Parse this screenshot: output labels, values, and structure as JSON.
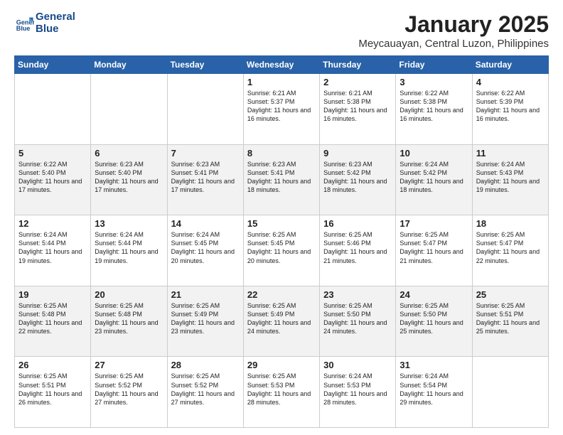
{
  "header": {
    "logo_line1": "General",
    "logo_line2": "Blue",
    "month": "January 2025",
    "location": "Meycauayan, Central Luzon, Philippines"
  },
  "weekdays": [
    "Sunday",
    "Monday",
    "Tuesday",
    "Wednesday",
    "Thursday",
    "Friday",
    "Saturday"
  ],
  "weeks": [
    [
      {
        "day": "",
        "text": ""
      },
      {
        "day": "",
        "text": ""
      },
      {
        "day": "",
        "text": ""
      },
      {
        "day": "1",
        "text": "Sunrise: 6:21 AM\nSunset: 5:37 PM\nDaylight: 11 hours and 16 minutes."
      },
      {
        "day": "2",
        "text": "Sunrise: 6:21 AM\nSunset: 5:38 PM\nDaylight: 11 hours and 16 minutes."
      },
      {
        "day": "3",
        "text": "Sunrise: 6:22 AM\nSunset: 5:38 PM\nDaylight: 11 hours and 16 minutes."
      },
      {
        "day": "4",
        "text": "Sunrise: 6:22 AM\nSunset: 5:39 PM\nDaylight: 11 hours and 16 minutes."
      }
    ],
    [
      {
        "day": "5",
        "text": "Sunrise: 6:22 AM\nSunset: 5:40 PM\nDaylight: 11 hours and 17 minutes."
      },
      {
        "day": "6",
        "text": "Sunrise: 6:23 AM\nSunset: 5:40 PM\nDaylight: 11 hours and 17 minutes."
      },
      {
        "day": "7",
        "text": "Sunrise: 6:23 AM\nSunset: 5:41 PM\nDaylight: 11 hours and 17 minutes."
      },
      {
        "day": "8",
        "text": "Sunrise: 6:23 AM\nSunset: 5:41 PM\nDaylight: 11 hours and 18 minutes."
      },
      {
        "day": "9",
        "text": "Sunrise: 6:23 AM\nSunset: 5:42 PM\nDaylight: 11 hours and 18 minutes."
      },
      {
        "day": "10",
        "text": "Sunrise: 6:24 AM\nSunset: 5:42 PM\nDaylight: 11 hours and 18 minutes."
      },
      {
        "day": "11",
        "text": "Sunrise: 6:24 AM\nSunset: 5:43 PM\nDaylight: 11 hours and 19 minutes."
      }
    ],
    [
      {
        "day": "12",
        "text": "Sunrise: 6:24 AM\nSunset: 5:44 PM\nDaylight: 11 hours and 19 minutes."
      },
      {
        "day": "13",
        "text": "Sunrise: 6:24 AM\nSunset: 5:44 PM\nDaylight: 11 hours and 19 minutes."
      },
      {
        "day": "14",
        "text": "Sunrise: 6:24 AM\nSunset: 5:45 PM\nDaylight: 11 hours and 20 minutes."
      },
      {
        "day": "15",
        "text": "Sunrise: 6:25 AM\nSunset: 5:45 PM\nDaylight: 11 hours and 20 minutes."
      },
      {
        "day": "16",
        "text": "Sunrise: 6:25 AM\nSunset: 5:46 PM\nDaylight: 11 hours and 21 minutes."
      },
      {
        "day": "17",
        "text": "Sunrise: 6:25 AM\nSunset: 5:47 PM\nDaylight: 11 hours and 21 minutes."
      },
      {
        "day": "18",
        "text": "Sunrise: 6:25 AM\nSunset: 5:47 PM\nDaylight: 11 hours and 22 minutes."
      }
    ],
    [
      {
        "day": "19",
        "text": "Sunrise: 6:25 AM\nSunset: 5:48 PM\nDaylight: 11 hours and 22 minutes."
      },
      {
        "day": "20",
        "text": "Sunrise: 6:25 AM\nSunset: 5:48 PM\nDaylight: 11 hours and 23 minutes."
      },
      {
        "day": "21",
        "text": "Sunrise: 6:25 AM\nSunset: 5:49 PM\nDaylight: 11 hours and 23 minutes."
      },
      {
        "day": "22",
        "text": "Sunrise: 6:25 AM\nSunset: 5:49 PM\nDaylight: 11 hours and 24 minutes."
      },
      {
        "day": "23",
        "text": "Sunrise: 6:25 AM\nSunset: 5:50 PM\nDaylight: 11 hours and 24 minutes."
      },
      {
        "day": "24",
        "text": "Sunrise: 6:25 AM\nSunset: 5:50 PM\nDaylight: 11 hours and 25 minutes."
      },
      {
        "day": "25",
        "text": "Sunrise: 6:25 AM\nSunset: 5:51 PM\nDaylight: 11 hours and 25 minutes."
      }
    ],
    [
      {
        "day": "26",
        "text": "Sunrise: 6:25 AM\nSunset: 5:51 PM\nDaylight: 11 hours and 26 minutes."
      },
      {
        "day": "27",
        "text": "Sunrise: 6:25 AM\nSunset: 5:52 PM\nDaylight: 11 hours and 27 minutes."
      },
      {
        "day": "28",
        "text": "Sunrise: 6:25 AM\nSunset: 5:52 PM\nDaylight: 11 hours and 27 minutes."
      },
      {
        "day": "29",
        "text": "Sunrise: 6:25 AM\nSunset: 5:53 PM\nDaylight: 11 hours and 28 minutes."
      },
      {
        "day": "30",
        "text": "Sunrise: 6:24 AM\nSunset: 5:53 PM\nDaylight: 11 hours and 28 minutes."
      },
      {
        "day": "31",
        "text": "Sunrise: 6:24 AM\nSunset: 5:54 PM\nDaylight: 11 hours and 29 minutes."
      },
      {
        "day": "",
        "text": ""
      }
    ]
  ]
}
